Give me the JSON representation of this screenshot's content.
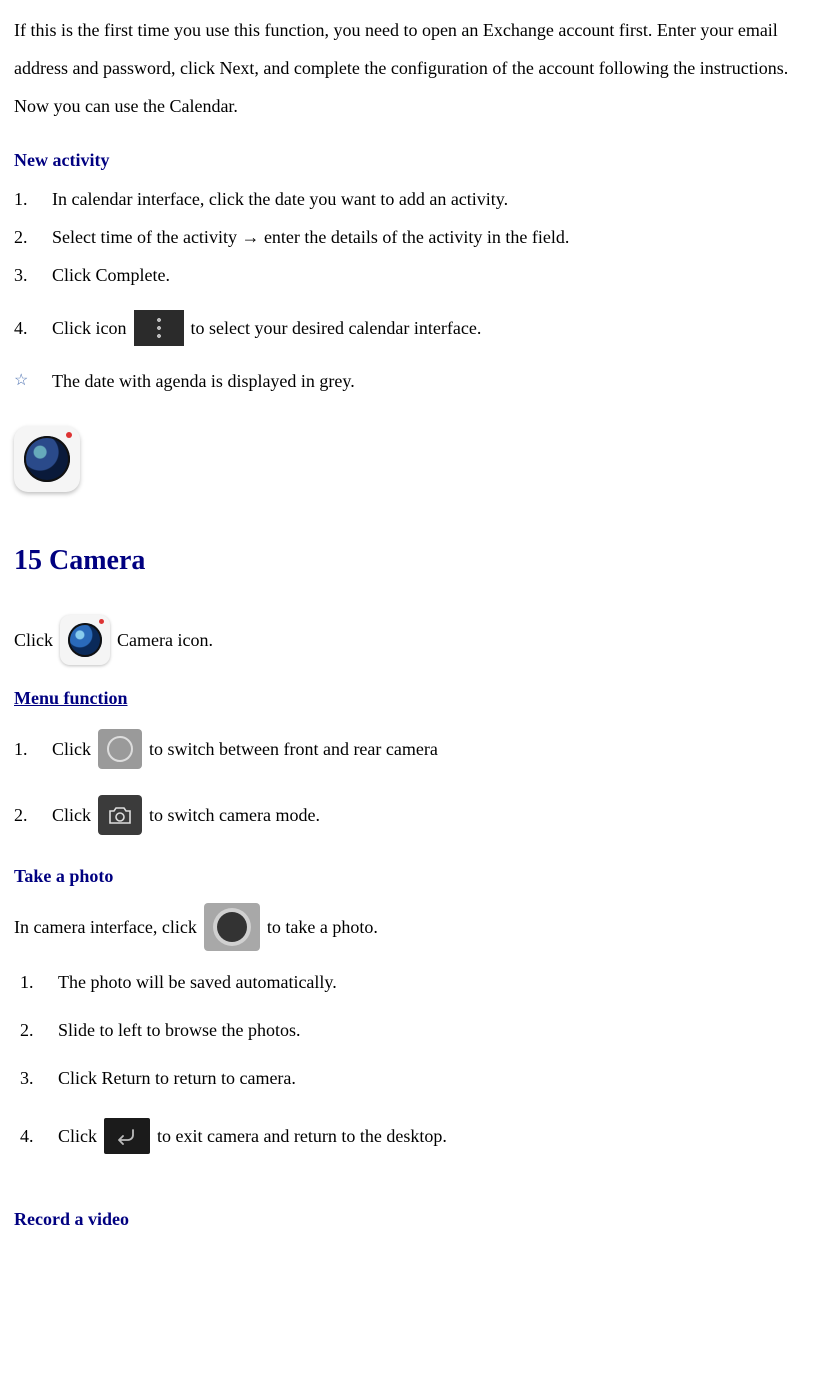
{
  "intro": "If this is the first time you use this function, you need to open an Exchange account first. Enter your email address and password, click Next, and complete the configuration of the account following the instructions. Now you can use the Calendar.",
  "new_activity": {
    "heading": "New activity",
    "items": {
      "n1": "1.",
      "t1": "In calendar interface, click the date you want to add an activity.",
      "n2": "2.",
      "t2": "Select time of the activity → enter the details of the activity in the field.",
      "n3": "3.",
      "t3": " Click Complete.",
      "n4": "4.",
      "t4a": " Click icon ",
      "t4b": " to select your desired calendar interface.",
      "star": "☆",
      "note": "The date with agenda is displayed in grey."
    }
  },
  "camera": {
    "title": "15 Camera",
    "open_a": "Click  ",
    "open_b": "Camera icon.",
    "menu_heading": "Menu function",
    "m1n": "1.",
    "m1a": "  Click",
    "m1b": " to switch between front and rear camera",
    "m2n": "2.",
    "m2a": "Click ",
    "m2b": "  to switch camera mode.",
    "photo_heading": "Take a photo",
    "photo_a": "In camera interface, click ",
    "photo_b": " to take a photo.",
    "p1n": "1.",
    "p1": "The photo will be saved automatically.",
    "p2n": "2.",
    "p2": "Slide to left to browse the photos.",
    "p3n": "3.",
    "p3": " Click Return to return to camera.",
    "p4n": "4.",
    "p4a": "Click",
    "p4b": " to exit camera and return to the desktop.",
    "video_heading": "Record a video"
  }
}
